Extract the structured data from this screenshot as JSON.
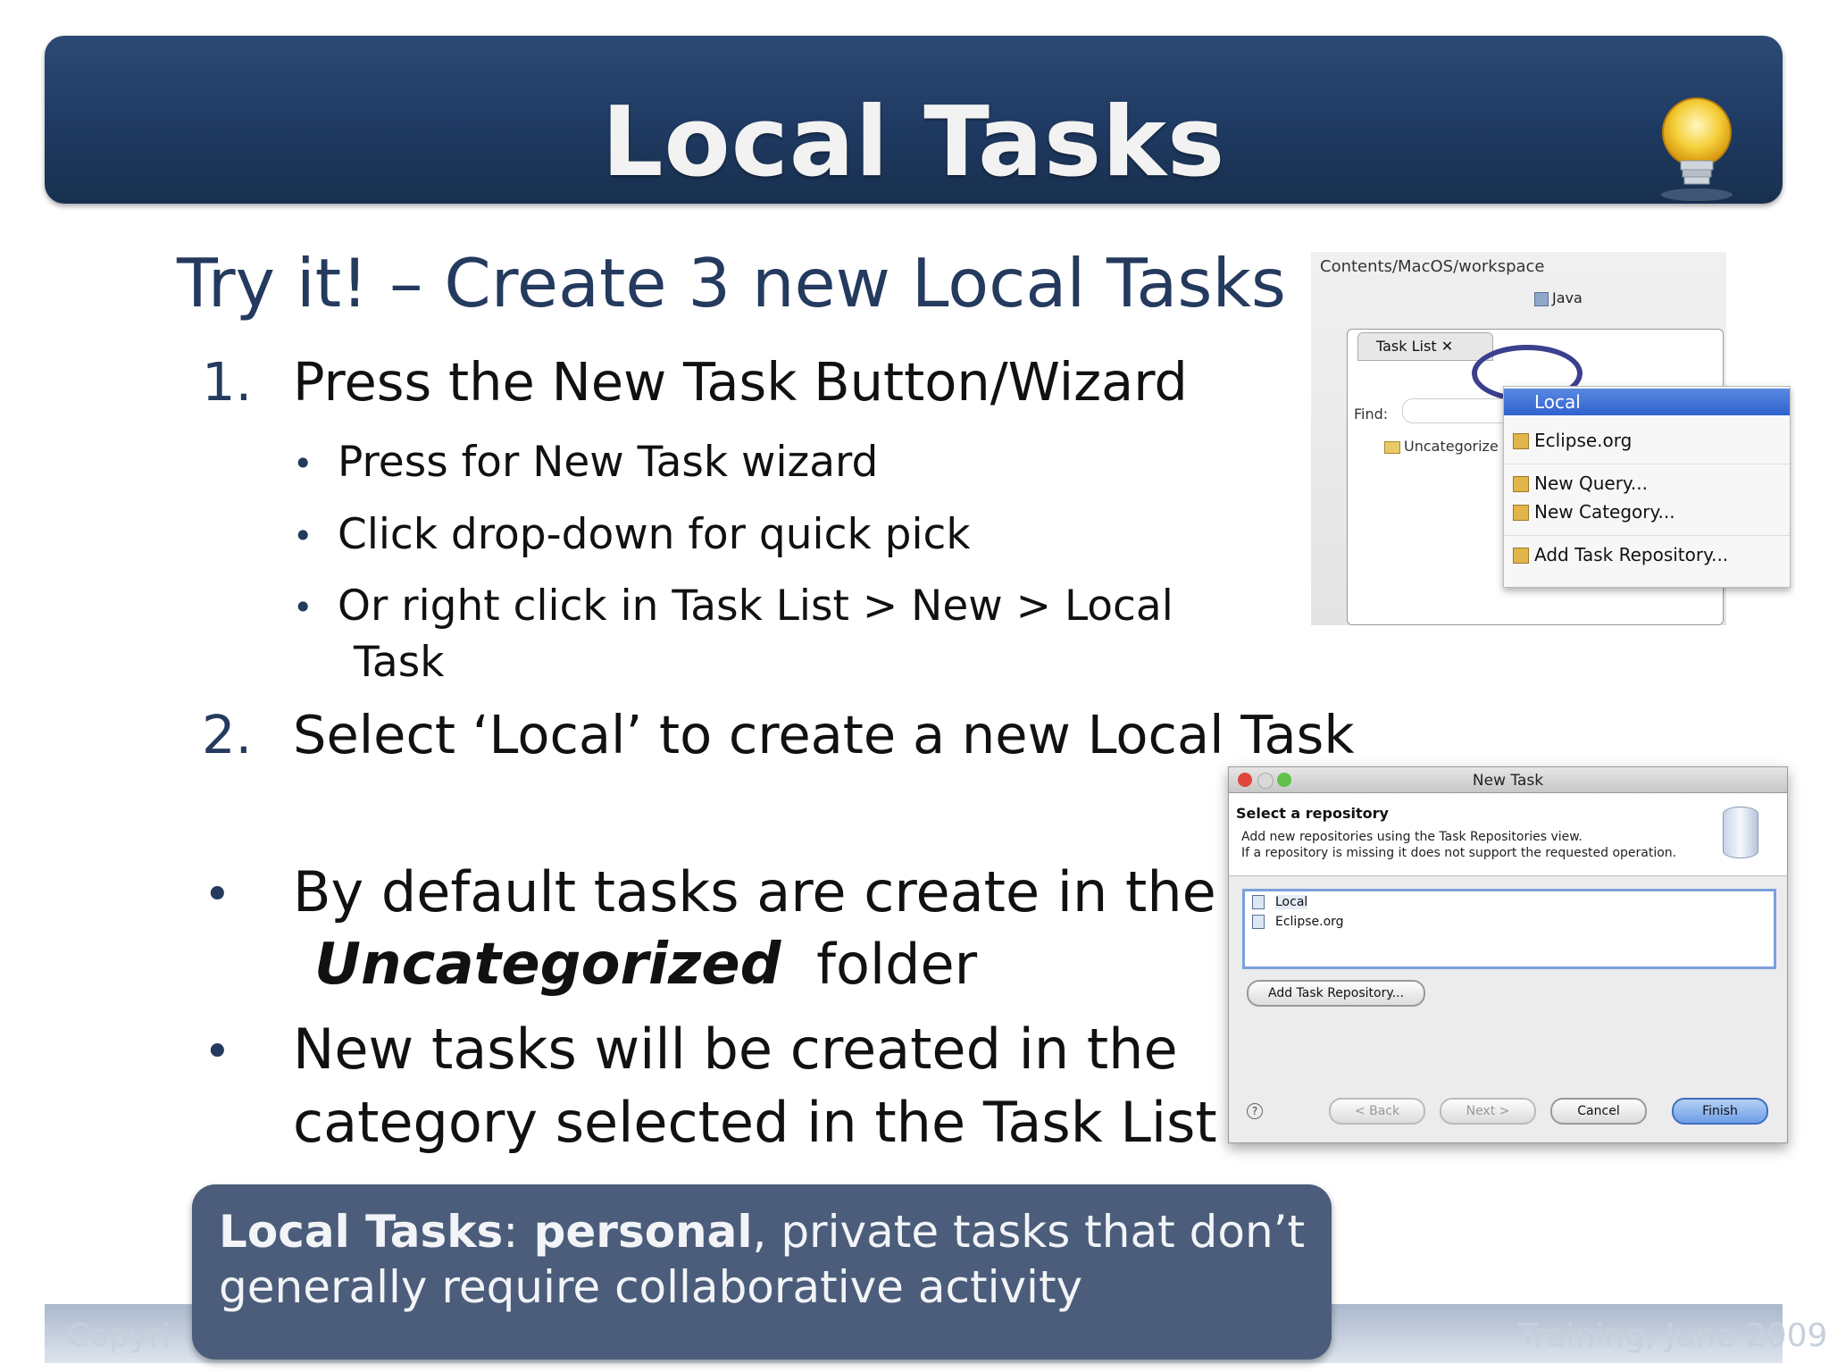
{
  "slide": {
    "title": "Local Tasks",
    "subtitle": "Try it! – Create 3 new Local Tasks",
    "steps": [
      {
        "num": "1.",
        "text": "Press the New Task Button/Wizard"
      },
      {
        "num": "2.",
        "text": "Select ‘Local’ to create a new Local Task"
      }
    ],
    "sub_bullets": [
      "Press for New Task wizard",
      "Click drop-down for quick pick",
      "Or right click in Task List > New > Local",
      "Task"
    ],
    "notes": {
      "default_line1": "By default tasks are create in the",
      "default_em": "Uncategorized",
      "default_tail": "folder",
      "new_line1": "New tasks will be created in the",
      "new_line2": "category selected in the Task List"
    },
    "callout": {
      "bold": "Local Tasks",
      "colon": ":",
      "bold2": " personal",
      "rest": ", private tasks that don’t generally require collaborative activity"
    },
    "footer": {
      "left": "Copyri",
      "right": "Training, June 2009"
    }
  },
  "menu_shot": {
    "path": "Contents/MacOS/workspace",
    "perspective": "Java",
    "view_tab": "Task List",
    "find_label": "Find:",
    "uncategorized": "Uncategorize",
    "items": [
      "Local",
      "Eclipse.org",
      "New Query...",
      "New Category...",
      "Add Task Repository..."
    ]
  },
  "dialog_shot": {
    "title": "New Task",
    "heading": "Select a repository",
    "desc1": "Add new repositories using the Task Repositories view.",
    "desc2": "If a repository is missing it does not support the requested operation.",
    "repos": [
      "Local",
      "Eclipse.org"
    ],
    "add_button": "Add Task Repository...",
    "help": "?",
    "back": "< Back",
    "next": "Next >",
    "cancel": "Cancel",
    "finish": "Finish"
  },
  "colors": {
    "banner": "#1f3a62",
    "accent": "#243a5e",
    "callout": "#4b5d7a"
  }
}
